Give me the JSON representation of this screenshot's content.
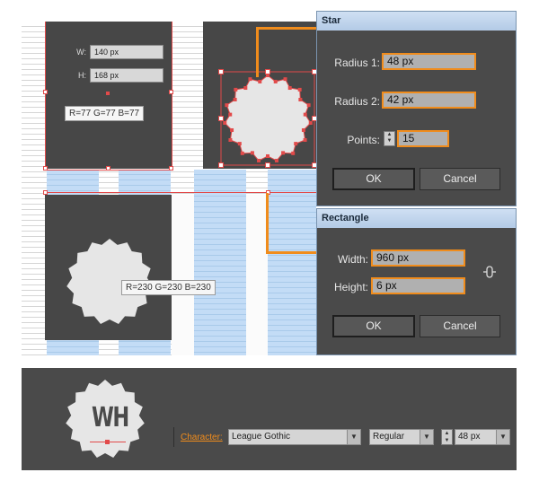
{
  "canvas": {
    "width_label": "W:",
    "width_value": "140 px",
    "height_label": "H:",
    "height_value": "168 px",
    "dark_tooltip": "R=77 G=77 B=77",
    "light_tooltip": "R=230 G=230 B=230"
  },
  "star_dialog": {
    "title": "Star",
    "radius1_label": "Radius 1:",
    "radius1_value": "48 px",
    "radius2_label": "Radius 2:",
    "radius2_value": "42 px",
    "points_label": "Points:",
    "points_value": "15",
    "ok_label": "OK",
    "cancel_label": "Cancel"
  },
  "rect_dialog": {
    "title": "Rectangle",
    "width_label": "Width:",
    "width_value": "960 px",
    "height_label": "Height:",
    "height_value": "6 px",
    "ok_label": "OK",
    "cancel_label": "Cancel",
    "link_icon": "link-constrain-icon"
  },
  "character_panel": {
    "logo_text": "WH",
    "character_label": "Character:",
    "font_family": "League Gothic",
    "font_style": "Regular",
    "font_size": "48 px"
  },
  "colors": {
    "dark_shape": "#4d4d4d",
    "light_shape": "#e6e6e6",
    "accent": "#f08c1c",
    "selection": "#e24a4a",
    "grid_blue": "#c3dcf6"
  }
}
